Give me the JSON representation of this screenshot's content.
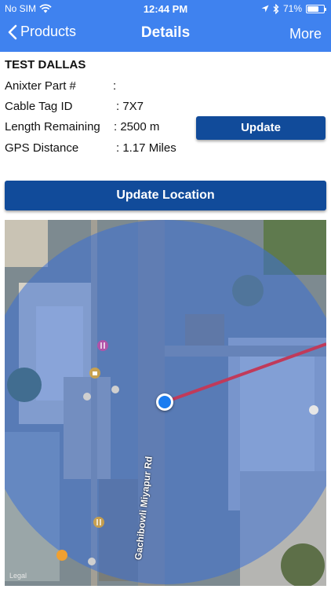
{
  "status_bar": {
    "carrier": "No SIM",
    "time": "12:44 PM",
    "battery_percent": "71%",
    "battery_level": 0.71
  },
  "nav": {
    "back_label": "Products",
    "title": "Details",
    "more_label": "More"
  },
  "details": {
    "name": "TEST DALLAS",
    "fields": [
      {
        "label": "Anixter Part #",
        "value": ":"
      },
      {
        "label": "Cable Tag ID",
        "value": ": 7X7"
      },
      {
        "label": "Length Remaining",
        "value": ": 2500 m"
      },
      {
        "label": "GPS Distance",
        "value": ":  1.17 Miles"
      }
    ],
    "update_label": "Update"
  },
  "update_location_label": "Update Location",
  "map": {
    "road_label": "Gachibowli Miyapur Rd",
    "accuracy_circle_color": "#3b6fd6",
    "route_line_color": "#c03a5a",
    "location_dot_color": "#1a7cf0"
  }
}
